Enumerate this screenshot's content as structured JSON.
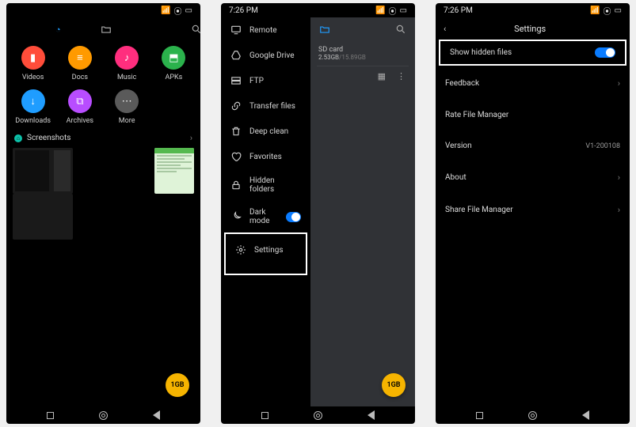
{
  "status": {
    "time": "7:26 PM"
  },
  "screen1": {
    "categories": [
      {
        "label": "Videos",
        "color": "#ff4d3a",
        "glyph": "▮"
      },
      {
        "label": "Docs",
        "color": "#ff9a00",
        "glyph": "≡"
      },
      {
        "label": "Music",
        "color": "#ff2e7e",
        "glyph": "♪"
      },
      {
        "label": "APKs",
        "color": "#2bb24c",
        "glyph": "⬒"
      },
      {
        "label": "Downloads",
        "color": "#1f9dff",
        "glyph": "↓"
      },
      {
        "label": "Archives",
        "color": "#b84dff",
        "glyph": "⧉"
      },
      {
        "label": "More",
        "color": "#5a5a5a",
        "glyph": "⋯"
      }
    ],
    "section_label": "Screenshots",
    "fab_label": "1GB"
  },
  "screen2": {
    "drawer_items": [
      {
        "label": "Remote",
        "icon": "monitor"
      },
      {
        "label": "Google Drive",
        "icon": "drive"
      },
      {
        "label": "FTP",
        "icon": "ftp"
      },
      {
        "label": "Transfer files",
        "icon": "link"
      },
      {
        "label": "Deep clean",
        "icon": "trash"
      },
      {
        "label": "Favorites",
        "icon": "heart"
      },
      {
        "label": "Hidden folders",
        "icon": "lock"
      },
      {
        "label": "Dark mode",
        "icon": "moon",
        "toggle": true
      },
      {
        "label": "Settings",
        "icon": "gear",
        "boxed": true
      }
    ],
    "sd_title": "SD card",
    "sd_used": "2.53GB",
    "sd_total": "15.89GB",
    "fab_label": "1GB"
  },
  "screen3": {
    "title": "Settings",
    "toggle_row": {
      "label": "Show hidden files",
      "on": true
    },
    "rows": [
      {
        "label": "Feedback",
        "chev": true
      },
      {
        "label": "Rate File Manager"
      },
      {
        "label": "Version",
        "value": "V1-200108"
      },
      {
        "label": "About",
        "chev": true
      },
      {
        "label": "Share File Manager",
        "chev": true
      }
    ]
  }
}
